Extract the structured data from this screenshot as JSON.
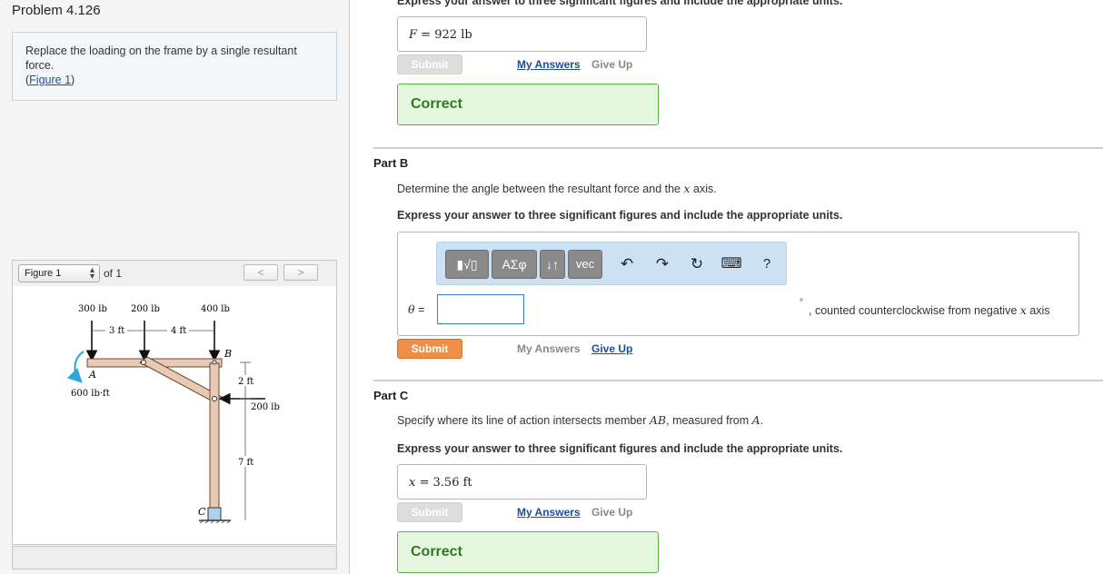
{
  "problem": {
    "title": "Problem 4.126",
    "statement": "Replace the loading on the frame by a single resultant force.",
    "figure_link": "Figure 1",
    "paren_open": "(",
    "paren_close": ")"
  },
  "figure_nav": {
    "selected": "Figure 1",
    "of_label": "of 1",
    "prev": "<",
    "next": ">"
  },
  "figure": {
    "labels": {
      "f300": "300 lb",
      "f200a": "200 lb",
      "f400": "400 lb",
      "d3ft": "3 ft",
      "d4ft": "4 ft",
      "pointA": "A",
      "pointB": "B",
      "pointC": "C",
      "moment": "600 lb·ft",
      "d2ft": "2 ft",
      "f200b": "200 lb",
      "d7ft": "7 ft"
    }
  },
  "part_a": {
    "cut_instruction": "Express your answer to three significant figures and include the appropriate units.",
    "var": "F",
    "eq": "=",
    "value": "922",
    "unit": "lb",
    "submit": "Submit",
    "my_answers": "My Answers",
    "give_up": "Give Up",
    "result": "Correct"
  },
  "part_b": {
    "title": "Part B",
    "question_pre": "Determine the angle between the resultant force and the ",
    "question_var": "x",
    "question_post": " axis.",
    "instruction": "Express your answer to three significant figures and include the appropriate units.",
    "toolbar": {
      "templates": "▮√▯",
      "greek": "ΑΣφ",
      "arrows": "↓↑",
      "vec": "vec",
      "undo": "↶",
      "redo": "↷",
      "reset": "↻",
      "keyboard": "⌨",
      "help": "?"
    },
    "var": "θ",
    "eq": "=",
    "input_value": "",
    "suffix_degree": "°",
    "suffix_pre": ", counted counterclockwise from negative ",
    "suffix_var": "x",
    "suffix_post": " axis",
    "submit": "Submit",
    "my_answers": "My Answers",
    "give_up": "Give Up"
  },
  "part_c": {
    "title": "Part C",
    "question_pre": "Specify where its line of action intersects member ",
    "question_member": "AB",
    "question_mid": ", measured from ",
    "question_point": "A",
    "question_post": ".",
    "instruction": "Express your answer to three significant figures and include the appropriate units.",
    "var": "x",
    "eq": "=",
    "value": "3.56",
    "unit": "ft",
    "submit": "Submit",
    "my_answers": "My Answers",
    "give_up": "Give Up",
    "result": "Correct"
  },
  "colors": {
    "submit_orange": "#f08d48",
    "correct_green": "#2d7a20",
    "link_blue": "#1a4f97",
    "toolbar_blue": "#cde1f5",
    "beam_fill": "#e8c9b4",
    "moment_arrow": "#2aa7d9"
  }
}
